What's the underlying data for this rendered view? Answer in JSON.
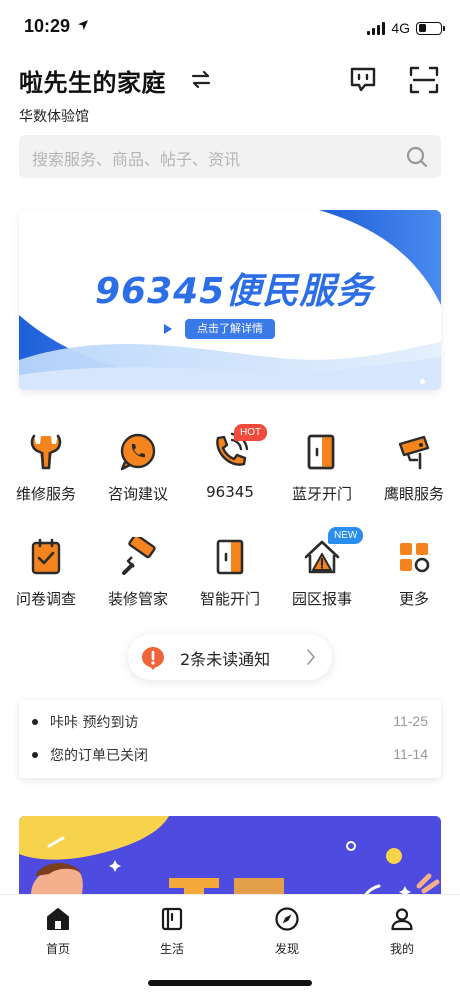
{
  "status_bar": {
    "time": "10:29",
    "network": "4G",
    "battery_level": 0.35
  },
  "header": {
    "home_name": "啦先生的家庭",
    "community": "华数体验馆"
  },
  "search": {
    "placeholder": "搜索服务、商品、帖子、资讯"
  },
  "banner": {
    "title": "96345便民服务",
    "button_label": "点击了解详情",
    "accent": "#2c6ee6"
  },
  "services": [
    {
      "label": "维修服务",
      "icon": "wrench-icon"
    },
    {
      "label": "咨询建议",
      "icon": "phone-bubble-icon"
    },
    {
      "label": "96345",
      "icon": "phone-call-icon",
      "badge": "HOT"
    },
    {
      "label": "蓝牙开门",
      "icon": "bluetooth-door-icon"
    },
    {
      "label": "鹰眼服务",
      "icon": "cctv-camera-icon"
    },
    {
      "label": "问卷调查",
      "icon": "clipboard-check-icon"
    },
    {
      "label": "装修管家",
      "icon": "paint-roller-icon"
    },
    {
      "label": "智能开门",
      "icon": "smart-door-icon"
    },
    {
      "label": "园区报事",
      "icon": "house-warning-icon",
      "badge": "NEW"
    },
    {
      "label": "更多",
      "icon": "grid-more-icon"
    }
  ],
  "notice": {
    "text": "2条未读通知"
  },
  "messages": [
    {
      "text": "咔咔 预约到访",
      "date": "11-25"
    },
    {
      "text": "您的订单已关闭",
      "date": "11-14"
    }
  ],
  "tabs": [
    {
      "label": "首页",
      "icon": "home-icon"
    },
    {
      "label": "生活",
      "icon": "life-icon"
    },
    {
      "label": "发现",
      "icon": "compass-icon"
    },
    {
      "label": "我的",
      "icon": "user-icon"
    }
  ],
  "colors": {
    "icon_orange": "#f5841f",
    "icon_dark": "#2b2b2b",
    "hot": "#f04b3a",
    "new": "#2a8ef0"
  }
}
